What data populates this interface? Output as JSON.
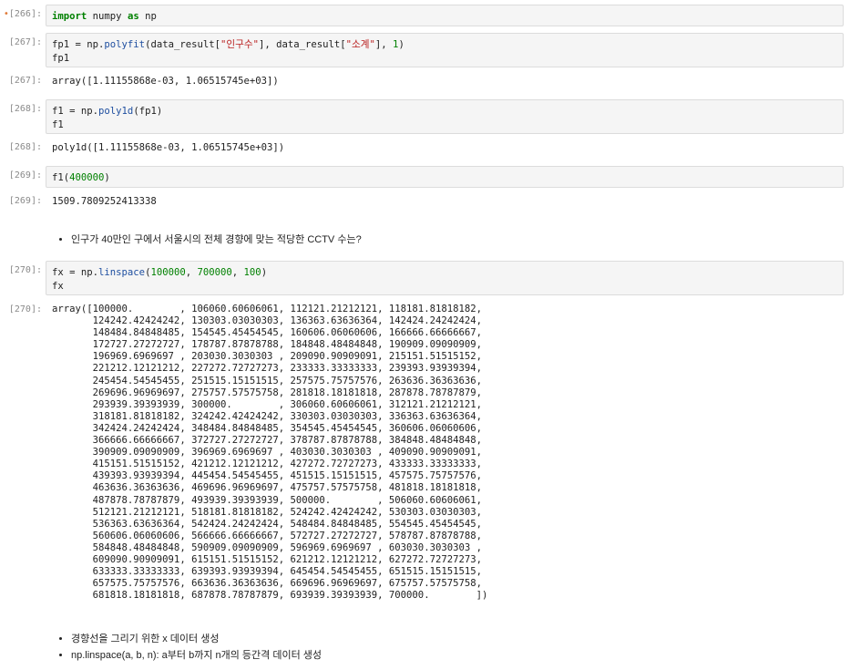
{
  "cells": [
    {
      "id": "c266",
      "prompt": "[266]:",
      "star": "•",
      "code": [
        [
          "kw",
          "import"
        ],
        [
          "t",
          " numpy "
        ],
        [
          "kw",
          "as"
        ],
        [
          "t",
          " np"
        ]
      ]
    },
    {
      "id": "c267",
      "prompt": "[267]:",
      "code": [
        [
          "t",
          "fp1 = np."
        ],
        [
          "fn",
          "polyfit"
        ],
        [
          "t",
          "(data_result["
        ],
        [
          "str",
          "\"인구수\""
        ],
        [
          "t",
          "], data_result["
        ],
        [
          "str",
          "\"소계\""
        ],
        [
          "t",
          "], "
        ],
        [
          "num",
          "1"
        ],
        [
          "t",
          ")\nfp1"
        ]
      ],
      "out_prompt": "[267]:",
      "output": "array([1.11155868e-03, 1.06515745e+03])"
    },
    {
      "id": "c268",
      "prompt": "[268]:",
      "code": [
        [
          "t",
          "f1 = np."
        ],
        [
          "fn",
          "poly1d"
        ],
        [
          "t",
          "(fp1)\nf1"
        ]
      ],
      "out_prompt": "[268]:",
      "output": "poly1d([1.11155868e-03, 1.06515745e+03])"
    },
    {
      "id": "c269",
      "prompt": "[269]:",
      "code": [
        [
          "t",
          "f1("
        ],
        [
          "num",
          "400000"
        ],
        [
          "t",
          ")"
        ]
      ],
      "out_prompt": "[269]:",
      "output": "1509.7809252413338"
    },
    {
      "id": "c270",
      "prompt": "[270]:",
      "code": [
        [
          "t",
          "fx = np."
        ],
        [
          "fn",
          "linspace"
        ],
        [
          "t",
          "("
        ],
        [
          "num",
          "100000"
        ],
        [
          "t",
          ", "
        ],
        [
          "num",
          "700000"
        ],
        [
          "t",
          ", "
        ],
        [
          "num",
          "100"
        ],
        [
          "t",
          ")\nfx"
        ]
      ],
      "out_prompt": "[270]:",
      "output": "array([100000.        , 106060.60606061, 112121.21212121, 118181.81818182,\n       124242.42424242, 130303.03030303, 136363.63636364, 142424.24242424,\n       148484.84848485, 154545.45454545, 160606.06060606, 166666.66666667,\n       172727.27272727, 178787.87878788, 184848.48484848, 190909.09090909,\n       196969.6969697 , 203030.3030303 , 209090.90909091, 215151.51515152,\n       221212.12121212, 227272.72727273, 233333.33333333, 239393.93939394,\n       245454.54545455, 251515.15151515, 257575.75757576, 263636.36363636,\n       269696.96969697, 275757.57575758, 281818.18181818, 287878.78787879,\n       293939.39393939, 300000.        , 306060.60606061, 312121.21212121,\n       318181.81818182, 324242.42424242, 330303.03030303, 336363.63636364,\n       342424.24242424, 348484.84848485, 354545.45454545, 360606.06060606,\n       366666.66666667, 372727.27272727, 378787.87878788, 384848.48484848,\n       390909.09090909, 396969.6969697 , 403030.3030303 , 409090.90909091,\n       415151.51515152, 421212.12121212, 427272.72727273, 433333.33333333,\n       439393.93939394, 445454.54545455, 451515.15151515, 457575.75757576,\n       463636.36363636, 469696.96969697, 475757.57575758, 481818.18181818,\n       487878.78787879, 493939.39393939, 500000.        , 506060.60606061,\n       512121.21212121, 518181.81818182, 524242.42424242, 530303.03030303,\n       536363.63636364, 542424.24242424, 548484.84848485, 554545.45454545,\n       560606.06060606, 566666.66666667, 572727.27272727, 578787.87878788,\n       584848.48484848, 590909.09090909, 596969.6969697 , 603030.3030303 ,\n       609090.90909091, 615151.51515152, 621212.12121212, 627272.72727273,\n       633333.33333333, 639393.93939394, 645454.54545455, 651515.15151515,\n       657575.75757576, 663636.36363636, 669696.96969697, 675757.57575758,\n       681818.18181818, 687878.78787879, 693939.39393939, 700000.        ])"
    }
  ],
  "markdown": {
    "note1": [
      "인구가 40만인 구에서 서울시의 전체 경향에 맞는 적당한 CCTV 수는?"
    ],
    "note2": [
      "경향선을 그리기 위한 x 데이터 생성",
      "np.linspace(a, b, n): a부터 b까지 n개의 등간격 데이터 생성"
    ]
  }
}
